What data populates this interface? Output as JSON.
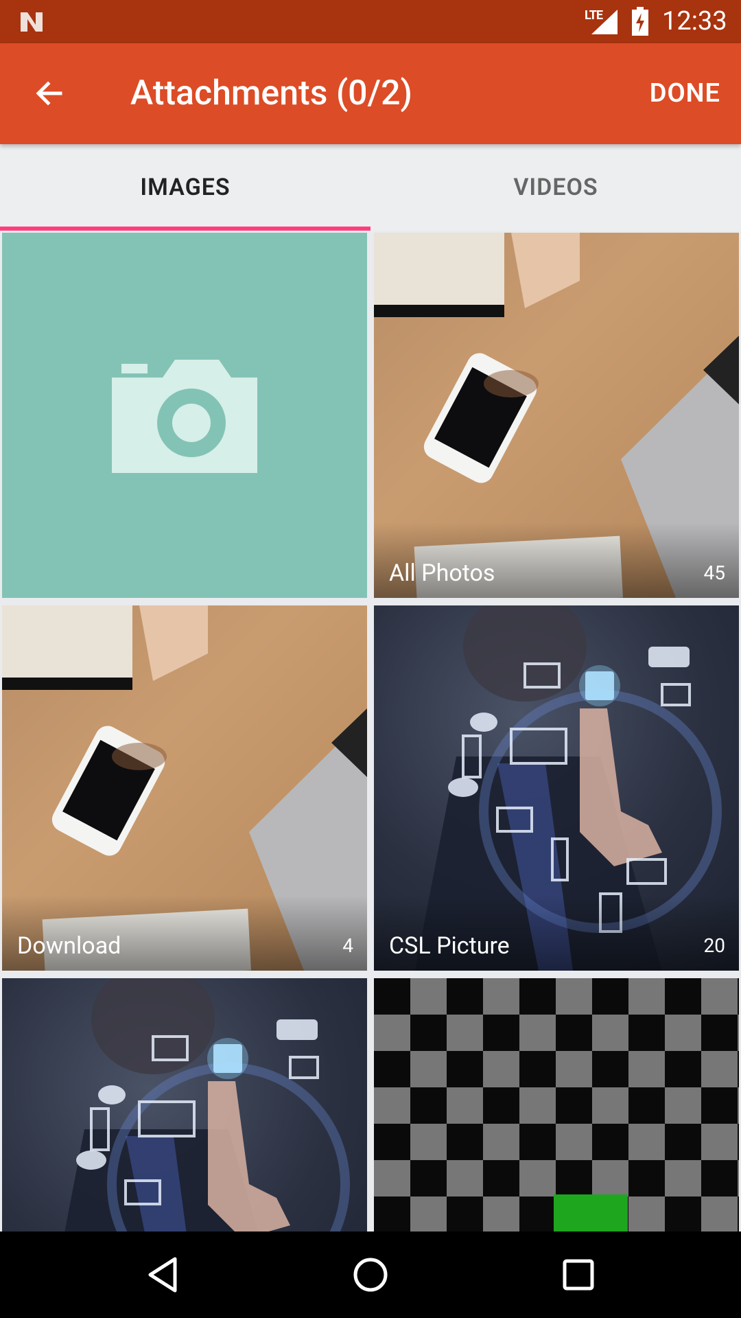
{
  "status_bar": {
    "network": "LTE",
    "time": "12:33"
  },
  "app_bar": {
    "title": "Attachments (0/2)",
    "done_label": "DONE"
  },
  "tabs": [
    {
      "label": "IMAGES",
      "active": true
    },
    {
      "label": "VIDEOS",
      "active": false
    }
  ],
  "albums": [
    {
      "label": "All Photos",
      "count": "45"
    },
    {
      "label": "Download",
      "count": "4"
    },
    {
      "label": "CSL Picture",
      "count": "20"
    }
  ],
  "colors": {
    "status_bar": "#a8330f",
    "app_bar": "#dc4c26",
    "tab_indicator": "#ff3e7f",
    "camera_tile": "#83c3b5"
  },
  "icons": {
    "back": "arrow-back-icon",
    "camera": "camera-icon",
    "nav_back": "triangle-back-icon",
    "nav_home": "circle-home-icon",
    "nav_recents": "square-recents-icon"
  }
}
